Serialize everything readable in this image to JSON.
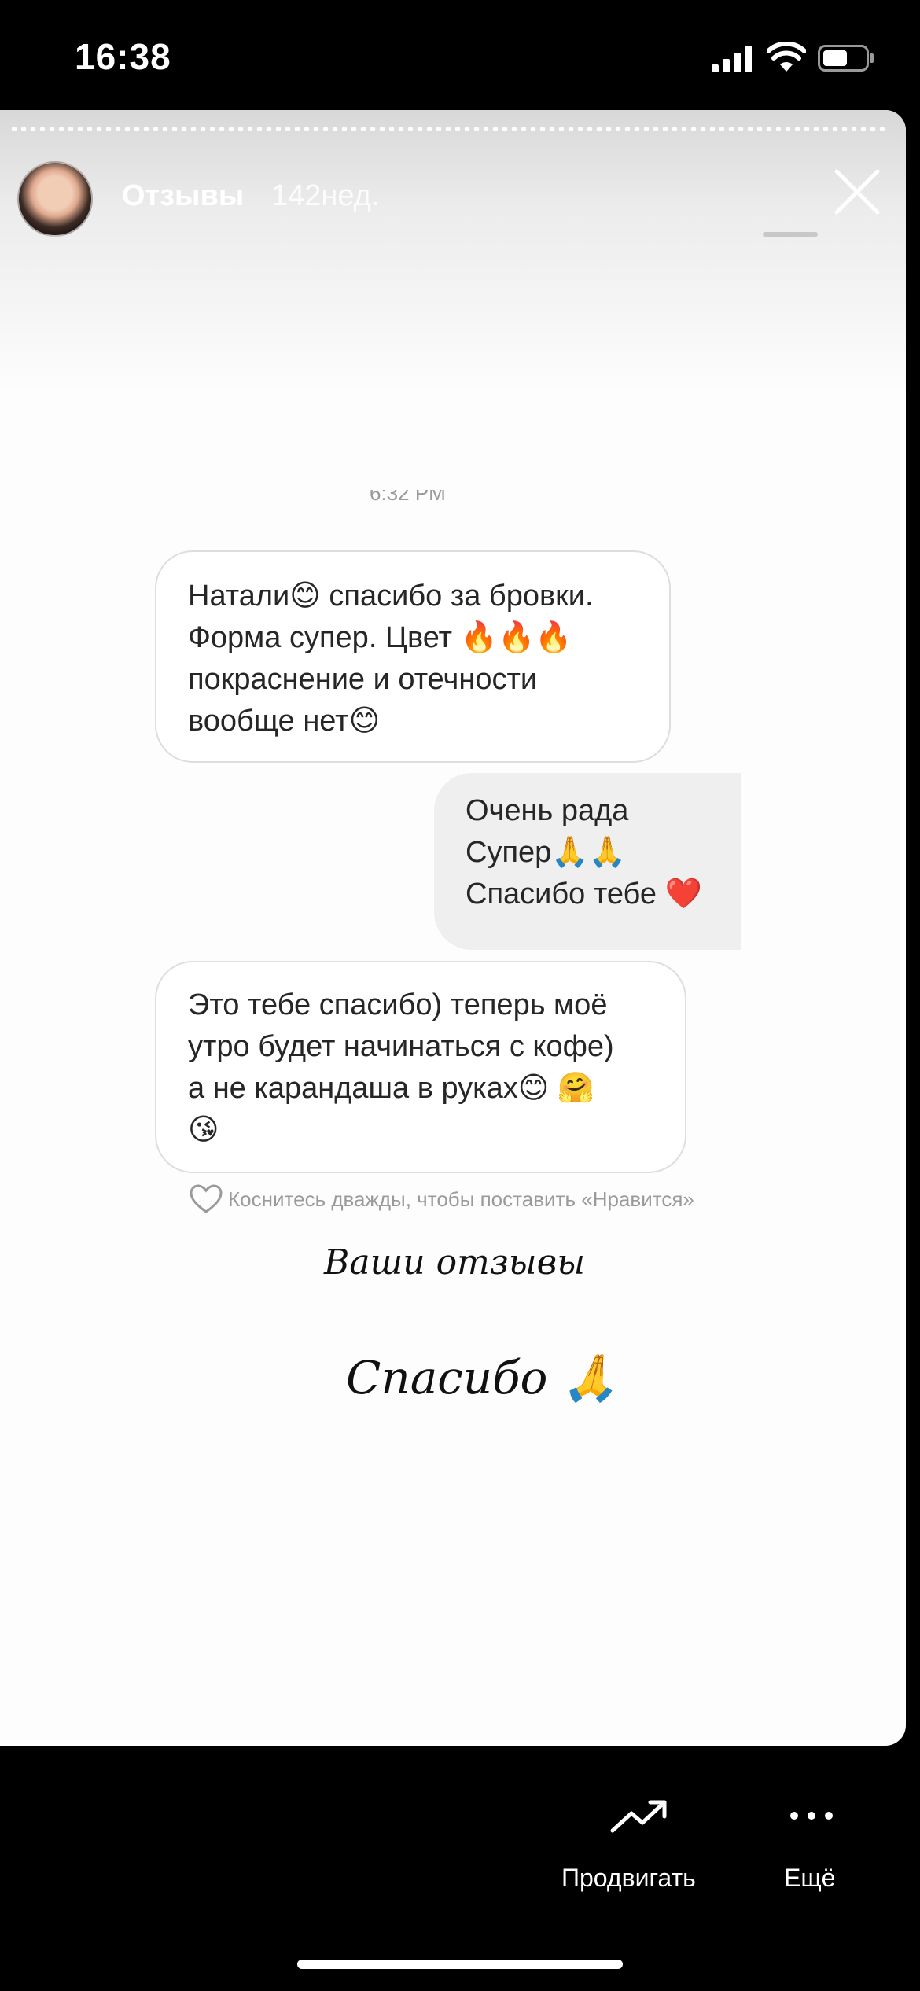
{
  "status_bar": {
    "time": "16:38"
  },
  "story": {
    "username": "Отзывы",
    "age": "142нед.",
    "timestamp_partial": "6:32 PM"
  },
  "messages": [
    {
      "from": "them",
      "lines": [
        "Натали😊 спасибо за бровки.",
        "Форма супер. Цвет 🔥🔥🔥",
        "покраснение и отечности",
        "вообще нет😊"
      ]
    },
    {
      "from": "me",
      "lines": [
        "Очень рада",
        "Супер🙏🙏",
        "Спасибо тебе ❤️"
      ]
    },
    {
      "from": "them",
      "lines": [
        "Это тебе спасибо) теперь моё",
        "утро будет начинаться с кофе)",
        "а не карандаша в руках😊 🤗",
        "😘"
      ]
    }
  ],
  "like_hint": "Коснитесь дважды, чтобы поставить «Нравится»",
  "caption": {
    "line1": "Ваши  отзывы",
    "line2": "Спасибо 🙏"
  },
  "actions": {
    "promote": "Продвигать",
    "more": "Ещё"
  }
}
